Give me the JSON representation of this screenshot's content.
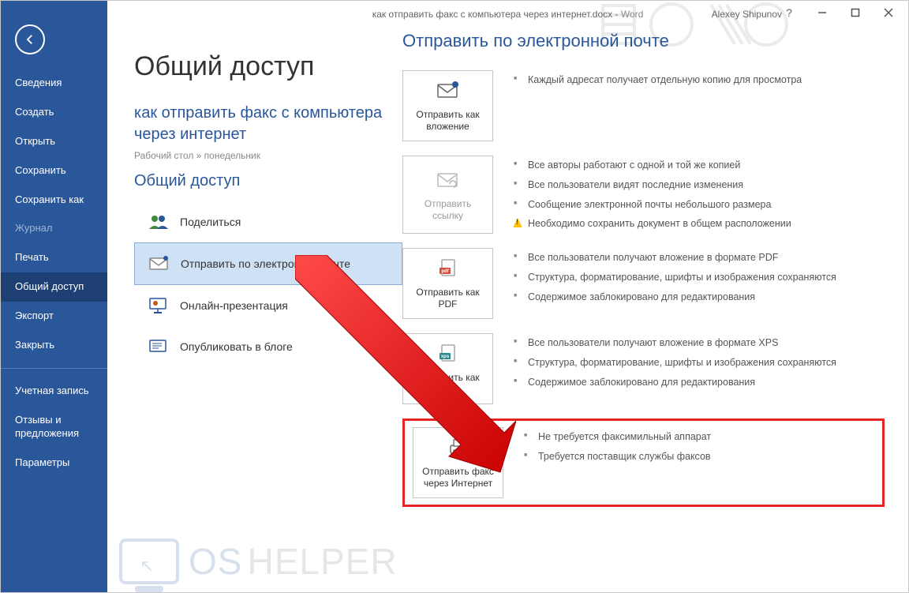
{
  "titlebar": {
    "doc_title": "как отправить факс с компьютера через интернет.docx",
    "separator": " - ",
    "app_name": "Word",
    "user_name": "Alexey Shipunov",
    "help": "?"
  },
  "sidebar": [
    {
      "key": "info",
      "label": "Сведения"
    },
    {
      "key": "new",
      "label": "Создать"
    },
    {
      "key": "open",
      "label": "Открыть"
    },
    {
      "key": "save",
      "label": "Сохранить"
    },
    {
      "key": "saveas",
      "label": "Сохранить как"
    },
    {
      "key": "history",
      "label": "Журнал",
      "dim": true
    },
    {
      "key": "print",
      "label": "Печать"
    },
    {
      "key": "share",
      "label": "Общий доступ",
      "active": true
    },
    {
      "key": "export",
      "label": "Экспорт"
    },
    {
      "key": "close",
      "label": "Закрыть"
    },
    {
      "key": "sep",
      "sep": true
    },
    {
      "key": "account",
      "label": "Учетная запись"
    },
    {
      "key": "feedback",
      "label": "Отзывы и предложения"
    },
    {
      "key": "options",
      "label": "Параметры"
    }
  ],
  "page": {
    "title": "Общий доступ",
    "doc_name": "как отправить факс с компьютера через интернет",
    "breadcrumb": "Рабочий стол » понедельник",
    "section_label": "Общий доступ",
    "share_opts": [
      {
        "key": "people",
        "label": "Поделиться"
      },
      {
        "key": "email",
        "label": "Отправить по электронной почте",
        "active": true
      },
      {
        "key": "online",
        "label": "Онлайн-презентация"
      },
      {
        "key": "blog",
        "label": "Опубликовать в блоге"
      }
    ]
  },
  "right": {
    "title": "Отправить по электронной почте",
    "options": [
      {
        "key": "attach",
        "label": "Отправить как вложение",
        "bullets": [
          "Каждый адресат получает отдельную копию для просмотра"
        ]
      },
      {
        "key": "link",
        "label": "Отправить ссылку",
        "disabled": true,
        "bullets": [
          "Все авторы работают с одной и той же копией",
          "Все пользователи видят последние изменения",
          "Сообщение электронной почты небольшого размера"
        ],
        "warn": "Необходимо сохранить документ в общем расположении"
      },
      {
        "key": "pdf",
        "label": "Отправить как PDF",
        "bullets": [
          "Все пользователи получают вложение в формате PDF",
          "Структура, форматирование, шрифты и изображения сохраняются",
          "Содержимое заблокировано для редактирования"
        ]
      },
      {
        "key": "xps",
        "label": "Отправить как XPS",
        "bullets": [
          "Все пользователи получают вложение в формате XPS",
          "Структура, форматирование, шрифты и изображения сохраняются",
          "Содержимое заблокировано для редактирования"
        ]
      },
      {
        "key": "fax",
        "label": "Отправить факс через Интернет",
        "highlight": true,
        "bullets": [
          "Не требуется факсимильный аппарат",
          "Требуется поставщик службы факсов"
        ]
      }
    ]
  },
  "watermark": {
    "brand1": "OS",
    "brand2": "HELPER"
  }
}
